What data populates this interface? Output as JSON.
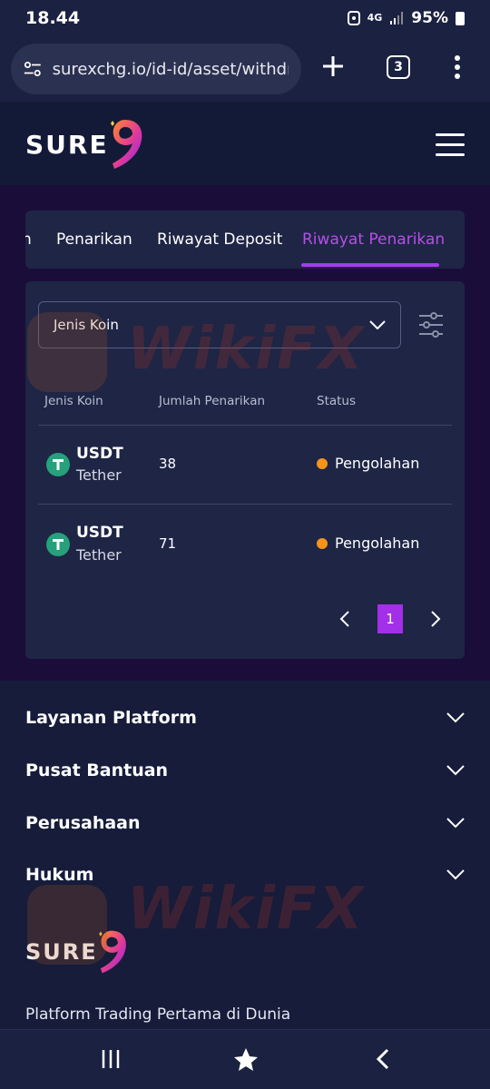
{
  "status_bar": {
    "time": "18.44",
    "network": "4G",
    "battery": "95%"
  },
  "browser": {
    "url": "surexchg.io/id-id/asset/withdraw",
    "tab_count": "3"
  },
  "site": {
    "logo_text": "SURE"
  },
  "tabs": {
    "items": [
      {
        "label": "n"
      },
      {
        "label": "Penarikan"
      },
      {
        "label": "Riwayat Deposit"
      },
      {
        "label": "Riwayat Penarikan"
      }
    ],
    "active": "Riwayat Penarikan"
  },
  "filter": {
    "coin_select_label": "Jenis Koin"
  },
  "table": {
    "headers": [
      "Jenis Koin",
      "Jumlah Penarikan",
      "Status"
    ],
    "rows": [
      {
        "symbol": "USDT",
        "name": "Tether",
        "amount": "38",
        "status": "Pengolahan"
      },
      {
        "symbol": "USDT",
        "name": "Tether",
        "amount": "71",
        "status": "Pengolahan"
      }
    ]
  },
  "pagination": {
    "current_page": "1"
  },
  "footer": {
    "sections": [
      {
        "label": "Layanan Platform"
      },
      {
        "label": "Pusat Bantuan"
      },
      {
        "label": "Perusahaan"
      },
      {
        "label": "Hukum"
      }
    ],
    "logo_text": "SURE",
    "tagline": "Platform Trading Pertama di Dunia"
  },
  "watermark": {
    "text": "WikiFX"
  },
  "colors": {
    "accent": "#a43ee6",
    "status_processing": "#f7931a",
    "tether": "#26a17b",
    "page_bg": "#151a36"
  }
}
